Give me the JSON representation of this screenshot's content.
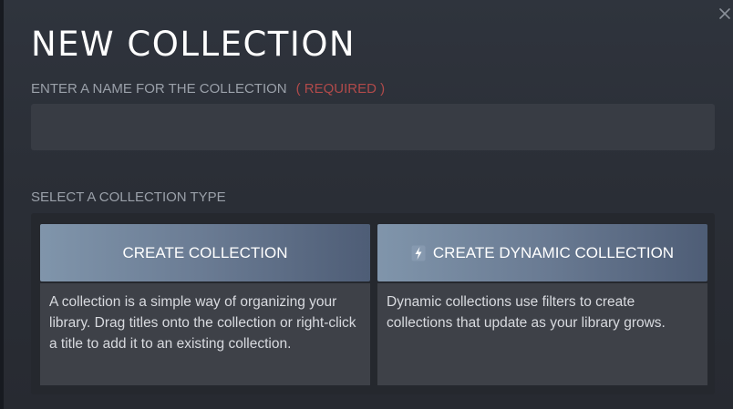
{
  "dialog": {
    "title": "NEW COLLECTION",
    "close_icon": "close-icon"
  },
  "name_field": {
    "label": "ENTER A NAME FOR THE COLLECTION",
    "required_label": "( REQUIRED )",
    "value": "",
    "placeholder": ""
  },
  "collection_type": {
    "label": "SELECT A COLLECTION TYPE",
    "options": [
      {
        "button_label": "CREATE COLLECTION",
        "icon": "",
        "description": "A collection is a simple way of organizing your library. Drag titles onto the collection or right-click a title to add it to an existing collection."
      },
      {
        "button_label": "CREATE DYNAMIC COLLECTION",
        "icon": "lightning-bolt-icon",
        "description": "Dynamic collections use filters to create collections that update as your library grows."
      }
    ]
  },
  "colors": {
    "background": "#2b2f37",
    "required_text": "#b04a4a",
    "button_gradient_start": "#8095ab",
    "button_gradient_end": "#4e5d76"
  }
}
